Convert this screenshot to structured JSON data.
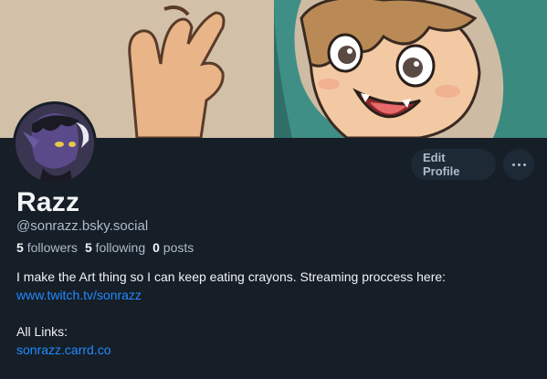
{
  "profile": {
    "display_name": "Razz",
    "handle": "@sonrazz.bsky.social",
    "edit_label": "Edit Profile",
    "more_icon": "ellipsis-icon",
    "stats": {
      "followers_count": "5",
      "followers_label": "followers",
      "following_count": "5",
      "following_label": "following",
      "posts_count": "0",
      "posts_label": "posts"
    },
    "bio": {
      "line1": "I make the Art thing so I can keep eating crayons. Streaming proccess here:",
      "link1": "www.twitch.tv/sonrazz",
      "line2": "All Links:",
      "link2": "sonrazz.carrd.co"
    }
  },
  "colors": {
    "background": "#161e27",
    "link": "#208bfe",
    "button_bg": "#1e2936",
    "muted_text": "#aebbc9"
  }
}
